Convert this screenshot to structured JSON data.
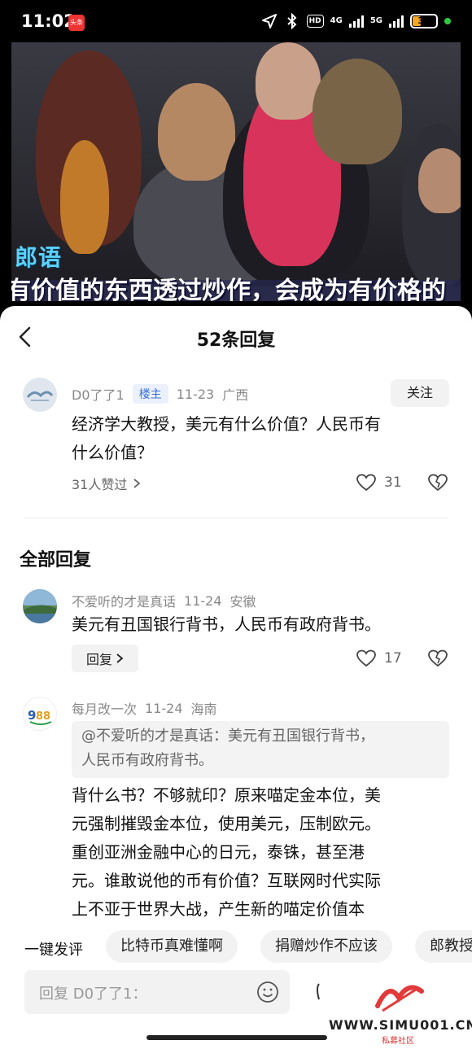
{
  "status": {
    "time": "11:02",
    "app_badge": "头条",
    "hd_label": "HD",
    "net1": "4G",
    "net2": "5G",
    "battery": "36",
    "battery_level": 0.36
  },
  "video": {
    "subtitle_tag": "郎语",
    "subtitle": "有价值的东西透过炒作，会成为有价格的"
  },
  "header": {
    "title": "52条回复"
  },
  "main_comment": {
    "user": "D0了了1",
    "owner_tag": "楼主",
    "date": "11-23",
    "location": "广西",
    "follow_label": "关注",
    "text_line1": "经济学大教授，美元有什么价值？人民币有",
    "text_line2": "什么价值？",
    "likers_text": "31人赞过",
    "like_count": "31"
  },
  "section_title": "全部回复",
  "replies": [
    {
      "user": "不爱听的才是真话",
      "date": "11-24",
      "location": "安徽",
      "text": "美元有丑国银行背书，人民币有政府背书。",
      "reply_label": "回复",
      "like_count": "17"
    },
    {
      "user": "每月改一次",
      "date": "11-24",
      "location": "海南",
      "quote_line1": "@不爱听的才是真话：美元有丑国银行背书，",
      "quote_line2": "人民币有政府背书。",
      "lines": [
        "背什么书？不够就印？原来喵定金本位，美",
        "元强制摧毁金本位，使用美元，压制欧元。",
        "重创亚洲金融中心的日元，泰铢，甚至港",
        "元。谁敢说他的币有价值？互联网时代实际",
        "上不亚于世界大战，产生新的喵定价值本"
      ]
    }
  ],
  "quick": {
    "label": "一键发评",
    "chips": [
      "比特币真难懂啊",
      "捐赠炒作不应该",
      "郎教授"
    ]
  },
  "input": {
    "placeholder": "回复 D0了了1："
  },
  "watermark": {
    "text": "WWW.SIMU001.CN",
    "sub": "私募社区"
  }
}
